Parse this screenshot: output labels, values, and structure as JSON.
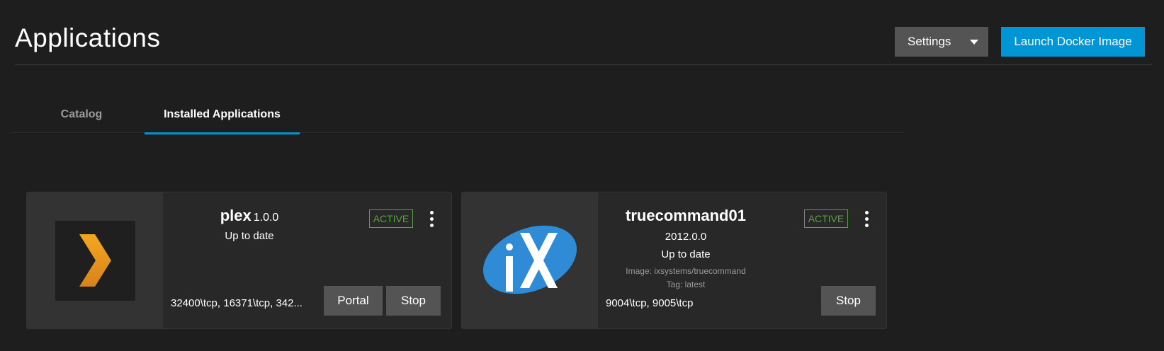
{
  "header": {
    "title": "Applications",
    "settings_label": "Settings",
    "launch_label": "Launch Docker Image"
  },
  "tabs": [
    {
      "label": "Catalog",
      "active": false
    },
    {
      "label": "Installed Applications",
      "active": true
    }
  ],
  "apps": [
    {
      "name": "plex",
      "version": "1.0.0",
      "update_status": "Up to date",
      "state": "ACTIVE",
      "ports": "32400\\tcp, 16371\\tcp, 342...",
      "buttons": [
        "Portal",
        "Stop"
      ],
      "icon": "plex-chevron-icon"
    },
    {
      "name": "truecommand01",
      "version": "2012.0.0",
      "update_status": "Up to date",
      "image": "Image: ixsystems/truecommand",
      "tag": "Tag: latest",
      "state": "ACTIVE",
      "ports": "9004\\tcp, 9005\\tcp",
      "buttons": [
        "Stop"
      ],
      "icon": "ix-logo-icon"
    }
  ],
  "colors": {
    "background": "#1e1e1e",
    "card": "#282828",
    "accent": "#0095d5",
    "active_badge": "#5aa045",
    "button_grey": "#545454"
  }
}
